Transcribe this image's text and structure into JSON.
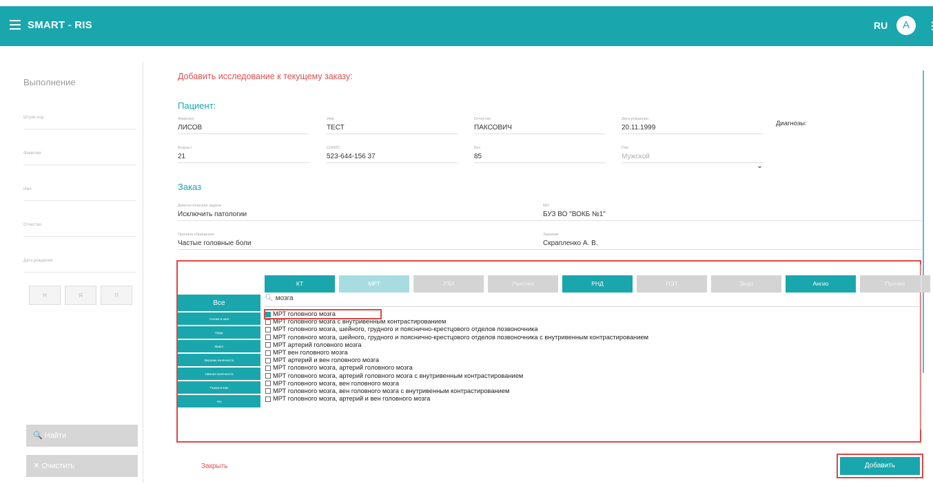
{
  "header": {
    "title": "SMART - RIS",
    "lang": "RU",
    "avatar": "A",
    "menu_icon": "hamburger-icon",
    "more_icon": "more-vert-icon"
  },
  "sidebar": {
    "title": "Выполнение",
    "fields": [
      "Штрих-код",
      "Фамилия",
      "Имя",
      "Отчество",
      "Дата рождения"
    ],
    "mini_buttons": [
      "Н",
      "Я",
      "П"
    ],
    "search_button": "Найти",
    "clear_button": "Очистить"
  },
  "main": {
    "title": "Добавить исследование к текущему заказу:",
    "patient_title": "Пациент:",
    "patient": {
      "surname_label": "Фамилия",
      "surname": "ЛИСОВ",
      "name_label": "Имя",
      "name": "ТЕСТ",
      "patronymic_label": "Отчество",
      "patronymic": "ПАКСОВИЧ",
      "dob_label": "Дата рождения",
      "dob": "20.11.1999",
      "age_label": "Возраст",
      "age": "21",
      "snils_label": "СНИЛС",
      "snils": "523-644-156 37",
      "weight_label": "Вес",
      "weight": "85",
      "sex_label": "Пол",
      "sex": "Мужской"
    },
    "diagnoses_label": "Диагнозы:",
    "order_title": "Заказ",
    "order": {
      "goal_label": "Диагностическая задача",
      "goal": "Исключить патологии",
      "mo_label": "МО",
      "mo": "БУЗ ВО \"ВОКБ №1\"",
      "reason_label": "Причина обращения",
      "reason": "Частые головные боли",
      "doctor_label": "Заказчик",
      "doctor": "Скрапленко А. В."
    }
  },
  "picker": {
    "categories": [
      {
        "label": "КТ",
        "state": "on"
      },
      {
        "label": "МРТ",
        "state": "half"
      },
      {
        "label": "УЗИ",
        "state": "off"
      },
      {
        "label": "Рентген",
        "state": "off"
      },
      {
        "label": "РНД",
        "state": "on"
      },
      {
        "label": "ПЭТ",
        "state": "off"
      },
      {
        "label": "Эндо",
        "state": "off"
      },
      {
        "label": "Ангио",
        "state": "on"
      },
      {
        "label": "Прочее",
        "state": "off"
      }
    ],
    "body_parts": [
      "Все",
      "Голова и шея",
      "Грудь",
      "Живот",
      "Верхние конечности",
      "Нижние конечности",
      "Позвоночник",
      "Таз"
    ],
    "search_value": "мозга",
    "items": [
      {
        "label": "МРТ головного мозга",
        "checked": true
      },
      {
        "label": "МРТ головного мозга с внутривенным контрастированием",
        "checked": false
      },
      {
        "label": "МРТ головного мозга, шейного, грудного и пояснично-крестцового отделов позвоночника",
        "checked": false
      },
      {
        "label": "МРТ головного мозга, шейного, грудного и пояснично-крестцового отделов позвоночника с внутривенным контрастированием",
        "checked": false
      },
      {
        "label": "МРТ артерий головного мозга",
        "checked": false
      },
      {
        "label": "МРТ вен головного мозга",
        "checked": false
      },
      {
        "label": "МРТ артерий и вен головного мозга",
        "checked": false
      },
      {
        "label": "МРТ головного мозга, артерий головного мозга",
        "checked": false
      },
      {
        "label": "МРТ головного мозга, артерий головного мозга с внутривенным контрастированием",
        "checked": false
      },
      {
        "label": "МРТ головного мозга, вен головного мозга",
        "checked": false
      },
      {
        "label": "МРТ головного мозга, вен головного мозга с внутривенным контрастированием",
        "checked": false
      },
      {
        "label": "МРТ головного мозга, артерий и вен головного мозга",
        "checked": false
      }
    ]
  },
  "actions": {
    "close": "Закрыть",
    "add": "Добавить"
  },
  "colors": {
    "accent": "#1aa6ad",
    "danger": "#e05050",
    "highlight": "#e04545"
  }
}
